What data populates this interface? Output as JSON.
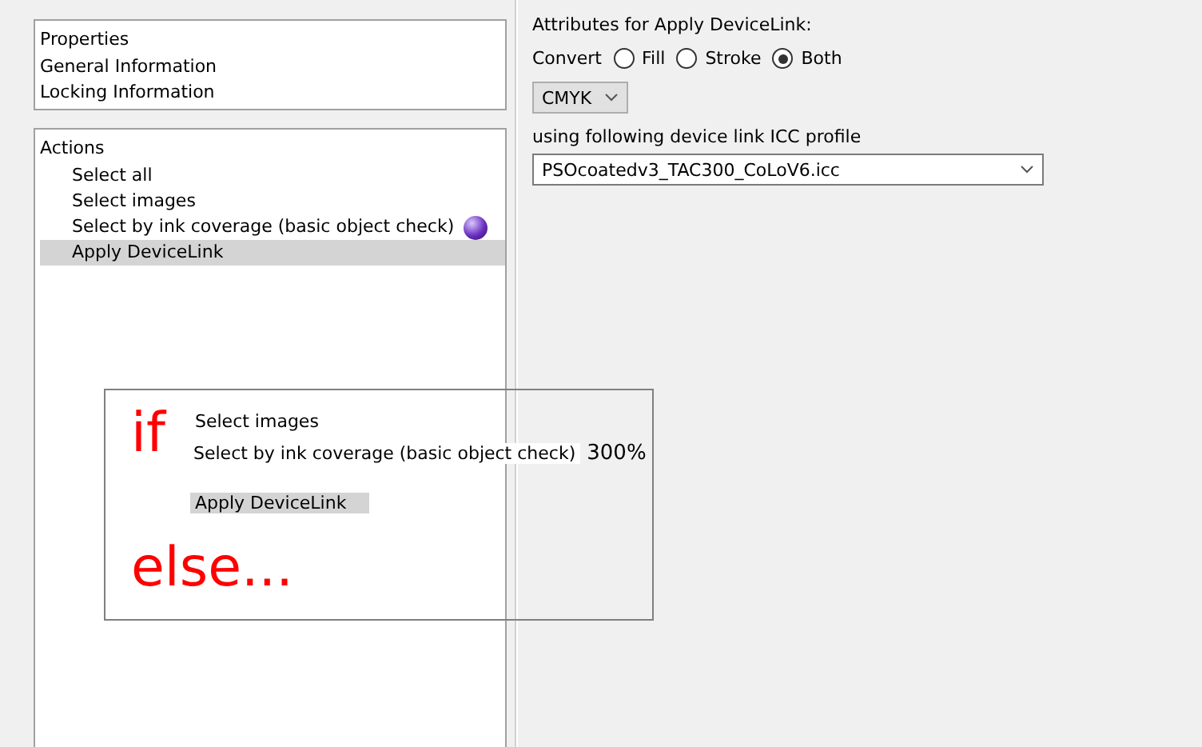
{
  "properties_panel": {
    "title": "Properties",
    "items": [
      {
        "label": "General Information",
        "selected": false
      },
      {
        "label": "Locking Information",
        "selected": false
      }
    ]
  },
  "actions_panel": {
    "title": "Actions",
    "items": [
      {
        "label": "Select all",
        "selected": false,
        "has_indicator": false
      },
      {
        "label": "Select images",
        "selected": false,
        "has_indicator": false
      },
      {
        "label": "Select by ink coverage (basic object check)",
        "selected": false,
        "has_indicator": true
      },
      {
        "label": "Apply DeviceLink",
        "selected": true,
        "has_indicator": false
      }
    ]
  },
  "attributes": {
    "title": "Attributes for Apply DeviceLink:",
    "convert_label": "Convert",
    "options": [
      {
        "label": "Fill",
        "selected": false
      },
      {
        "label": "Stroke",
        "selected": false
      },
      {
        "label": "Both",
        "selected": true
      }
    ],
    "color_space": "CMYK",
    "profile_label": "using following device link ICC profile",
    "profile": "PSOcoatedv3_TAC300_CoLoV6.icc"
  },
  "annotation": {
    "if_label": "if",
    "else_label": "else...",
    "items": [
      {
        "label": "Select images",
        "kind": "plain"
      },
      {
        "label": "Select by ink coverage (basic object check)",
        "kind": "boxed",
        "suffix": "300%"
      },
      {
        "label": "Apply DeviceLink",
        "kind": "highlighted"
      }
    ]
  }
}
